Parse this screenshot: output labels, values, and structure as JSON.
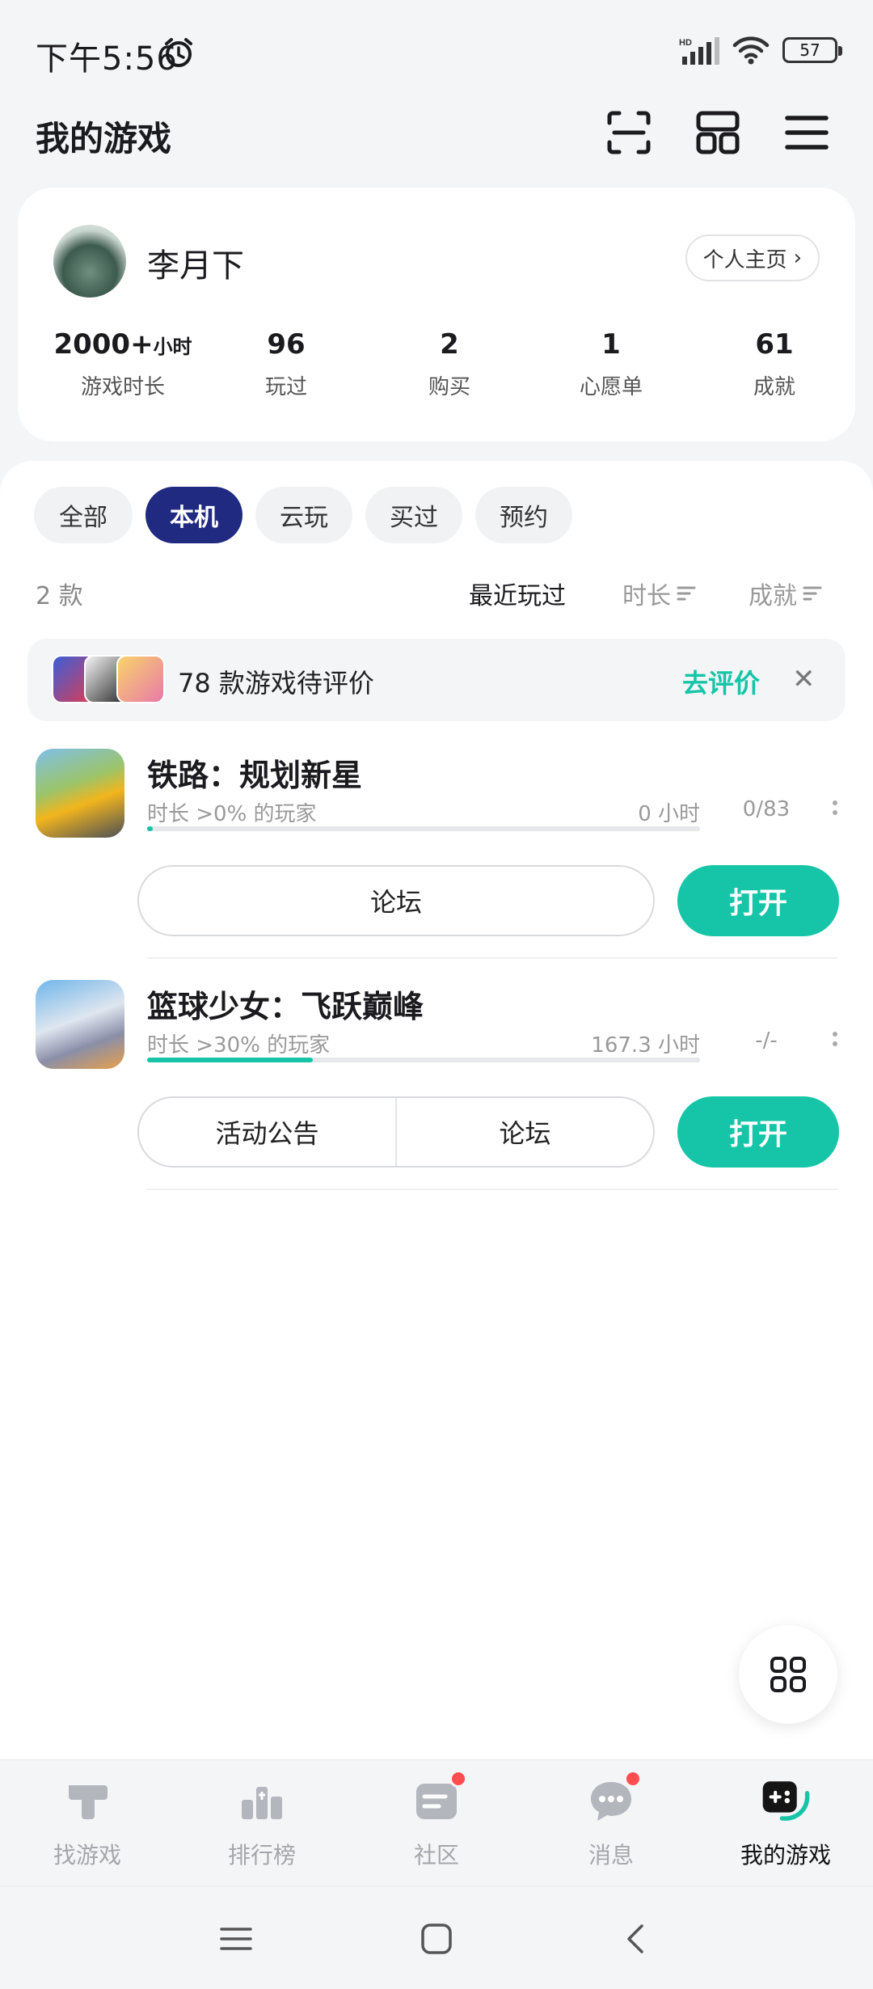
{
  "status_bar": {
    "time": "下午5:56",
    "battery": "57",
    "network": "HD"
  },
  "header": {
    "title": "我的游戏"
  },
  "profile": {
    "name": "李月下",
    "homepage_label": "个人主页",
    "stats": [
      {
        "value": "2000+",
        "unit": "小时",
        "label": "游戏时长"
      },
      {
        "value": "96",
        "unit": "",
        "label": "玩过"
      },
      {
        "value": "2",
        "unit": "",
        "label": "购买"
      },
      {
        "value": "1",
        "unit": "",
        "label": "心愿单"
      },
      {
        "value": "61",
        "unit": "",
        "label": "成就"
      }
    ]
  },
  "filters": [
    "全部",
    "本机",
    "云玩",
    "买过",
    "预约"
  ],
  "active_filter": "本机",
  "list": {
    "count": "2 款",
    "sort_options": [
      "最近玩过",
      "时长",
      "成就"
    ]
  },
  "review_banner": {
    "text": "78 款游戏待评价",
    "action": "去评价"
  },
  "games": [
    {
      "title": "铁路：规划新星",
      "subtitle": "时长 >0% 的玩家",
      "hours": "0 小时",
      "achievements": "0/83",
      "progress": 0.01,
      "actions": [
        "论坛"
      ],
      "open_label": "打开"
    },
    {
      "title": "篮球少女：飞跃巅峰",
      "subtitle": "时长 >30% 的玩家",
      "hours": "167.3 小时",
      "achievements": "-/-",
      "progress": 0.3,
      "actions": [
        "活动公告",
        "论坛"
      ],
      "open_label": "打开"
    }
  ],
  "bottom_nav": [
    {
      "label": "找游戏",
      "icon": "find-games-icon",
      "badge": false
    },
    {
      "label": "排行榜",
      "icon": "ranking-icon",
      "badge": false
    },
    {
      "label": "社区",
      "icon": "community-icon",
      "badge": true
    },
    {
      "label": "消息",
      "icon": "message-icon",
      "badge": true
    },
    {
      "label": "我的游戏",
      "icon": "my-games-icon",
      "badge": false,
      "active": true
    }
  ],
  "colors": {
    "accent": "#16c5a8",
    "active_chip": "#1f2a80",
    "badge": "#ff4d4f"
  }
}
